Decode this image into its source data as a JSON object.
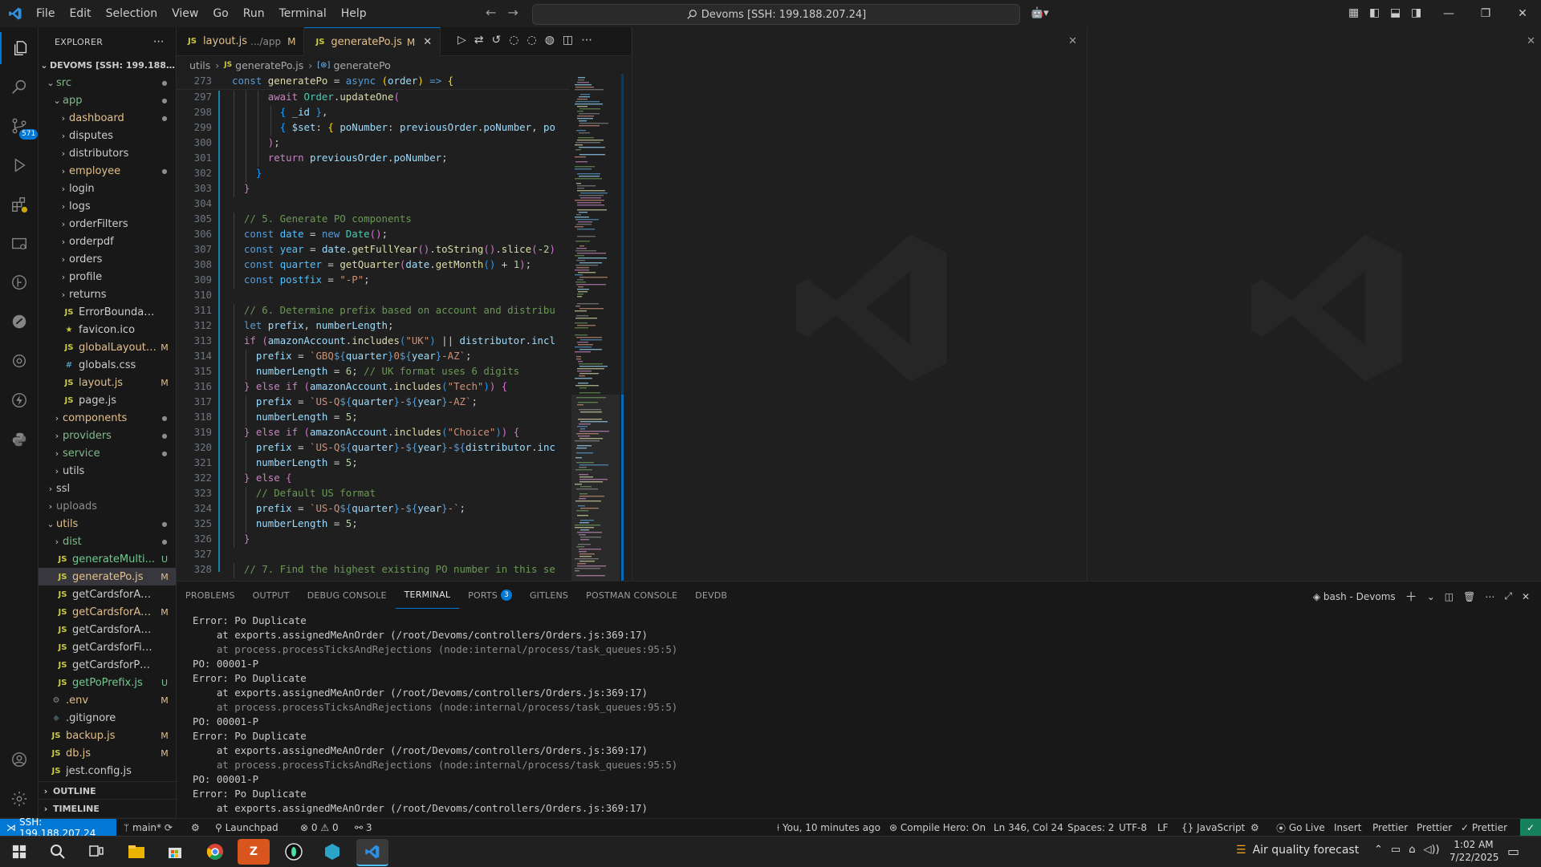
{
  "titlebar": {
    "menu": [
      "File",
      "Edit",
      "Selection",
      "View",
      "Go",
      "Run",
      "Terminal",
      "Help"
    ],
    "command_center": "Devoms [SSH: 199.188.207.24]"
  },
  "sidebar": {
    "title": "EXPLORER",
    "root": "DEVOMS [SSH: 199.188.20...",
    "rows": [
      {
        "label": "src",
        "type": "folder",
        "open": true,
        "indent": 1,
        "status": "dot",
        "color": "green"
      },
      {
        "label": "app",
        "type": "folder",
        "open": true,
        "indent": 2,
        "status": "dot",
        "color": "green"
      },
      {
        "label": "dashboard",
        "type": "folder",
        "open": false,
        "indent": 3,
        "status": "dot",
        "color": "mod"
      },
      {
        "label": "disputes",
        "type": "folder",
        "open": false,
        "indent": 3,
        "status": "",
        "color": "plain"
      },
      {
        "label": "distributors",
        "type": "folder",
        "open": false,
        "indent": 3,
        "status": "",
        "color": "plain"
      },
      {
        "label": "employee",
        "type": "folder",
        "open": false,
        "indent": 3,
        "status": "dot",
        "color": "mod"
      },
      {
        "label": "login",
        "type": "folder",
        "open": false,
        "indent": 3,
        "status": "",
        "color": "plain"
      },
      {
        "label": "logs",
        "type": "folder",
        "open": false,
        "indent": 3,
        "status": "",
        "color": "plain"
      },
      {
        "label": "orderFilters",
        "type": "folder",
        "open": false,
        "indent": 3,
        "status": "",
        "color": "plain"
      },
      {
        "label": "orderpdf",
        "type": "folder",
        "open": false,
        "indent": 3,
        "status": "",
        "color": "plain"
      },
      {
        "label": "orders",
        "type": "folder",
        "open": false,
        "indent": 3,
        "status": "",
        "color": "plain"
      },
      {
        "label": "profile",
        "type": "folder",
        "open": false,
        "indent": 3,
        "status": "",
        "color": "plain"
      },
      {
        "label": "returns",
        "type": "folder",
        "open": false,
        "indent": 3,
        "status": "",
        "color": "plain"
      },
      {
        "label": "ErrorBoundary.js",
        "type": "js",
        "indent": 3,
        "status": "",
        "color": "plain"
      },
      {
        "label": "favicon.ico",
        "type": "star",
        "indent": 3,
        "status": "",
        "color": "plain"
      },
      {
        "label": "globalLayout.js",
        "type": "js",
        "indent": 3,
        "status": "M",
        "color": "mod"
      },
      {
        "label": "globals.css",
        "type": "css",
        "indent": 3,
        "status": "",
        "color": "plain"
      },
      {
        "label": "layout.js",
        "type": "js",
        "indent": 3,
        "status": "M",
        "color": "mod"
      },
      {
        "label": "page.js",
        "type": "js",
        "indent": 3,
        "status": "",
        "color": "plain"
      },
      {
        "label": "components",
        "type": "folder",
        "open": false,
        "indent": 2,
        "status": "dot",
        "color": "mod"
      },
      {
        "label": "providers",
        "type": "folder",
        "open": false,
        "indent": 2,
        "status": "dot",
        "color": "green"
      },
      {
        "label": "service",
        "type": "folder",
        "open": false,
        "indent": 2,
        "status": "dot",
        "color": "green"
      },
      {
        "label": "utils",
        "type": "folder",
        "open": false,
        "indent": 2,
        "status": "",
        "color": "plain"
      },
      {
        "label": "ssl",
        "type": "folder",
        "open": false,
        "indent": 1,
        "status": "",
        "color": "plain"
      },
      {
        "label": "uploads",
        "type": "folder",
        "open": false,
        "indent": 1,
        "status": "",
        "color": "dim"
      },
      {
        "label": "utils",
        "type": "folder",
        "open": true,
        "indent": 1,
        "status": "dot",
        "color": "mod"
      },
      {
        "label": "dist",
        "type": "folder",
        "open": false,
        "indent": 2,
        "status": "dot",
        "color": "green"
      },
      {
        "label": "generateMulti...",
        "type": "js",
        "indent": 2,
        "status": "U",
        "color": "untracked"
      },
      {
        "label": "generatePo.js",
        "type": "js",
        "indent": 2,
        "status": "M",
        "color": "mod",
        "selected": true
      },
      {
        "label": "getCardsforAccount.js",
        "type": "js",
        "indent": 2,
        "status": "",
        "color": "plain"
      },
      {
        "label": "getCardsforAd...",
        "type": "js",
        "indent": 2,
        "status": "M",
        "color": "mod"
      },
      {
        "label": "getCardsforAmazon.js",
        "type": "js",
        "indent": 2,
        "status": "",
        "color": "plain"
      },
      {
        "label": "getCardsforFinance.js",
        "type": "js",
        "indent": 2,
        "status": "",
        "color": "plain"
      },
      {
        "label": "getCardsforPurchasi...",
        "type": "js",
        "indent": 2,
        "status": "",
        "color": "plain"
      },
      {
        "label": "getPoPrefix.js",
        "type": "js",
        "indent": 2,
        "status": "U",
        "color": "untracked"
      },
      {
        "label": ".env",
        "type": "gear",
        "indent": 1,
        "status": "M",
        "color": "mod"
      },
      {
        "label": ".gitignore",
        "type": "git",
        "indent": 1,
        "status": "",
        "color": "plain"
      },
      {
        "label": "backup.js",
        "type": "js",
        "indent": 1,
        "status": "M",
        "color": "mod"
      },
      {
        "label": "db.js",
        "type": "js",
        "indent": 1,
        "status": "M",
        "color": "mod"
      },
      {
        "label": "jest.config.js",
        "type": "js",
        "indent": 1,
        "status": "",
        "color": "plain"
      }
    ],
    "outline": "OUTLINE",
    "timeline": "TIMELINE"
  },
  "tabs": [
    {
      "label": "layout.js",
      "desc": ".../app",
      "status": "M",
      "active": false
    },
    {
      "label": "generatePo.js",
      "desc": "",
      "status": "M",
      "active": true
    }
  ],
  "breadcrumb": [
    "utils",
    "generatePo.js",
    "generatePo"
  ],
  "code": {
    "sticky_line": "273",
    "lines": [
      {
        "n": "297",
        "i": 3
      },
      {
        "n": "298",
        "i": 4
      },
      {
        "n": "299",
        "i": 4
      },
      {
        "n": "300",
        "i": 3
      },
      {
        "n": "301",
        "i": 3
      },
      {
        "n": "302",
        "i": 2
      },
      {
        "n": "303",
        "i": 1
      },
      {
        "n": "304",
        "i": 0
      },
      {
        "n": "305",
        "i": 1
      },
      {
        "n": "306",
        "i": 1
      },
      {
        "n": "307",
        "i": 1
      },
      {
        "n": "308",
        "i": 1
      },
      {
        "n": "309",
        "i": 1
      },
      {
        "n": "310",
        "i": 0
      },
      {
        "n": "311",
        "i": 1
      },
      {
        "n": "312",
        "i": 1
      },
      {
        "n": "313",
        "i": 1
      },
      {
        "n": "314",
        "i": 2
      },
      {
        "n": "315",
        "i": 2
      },
      {
        "n": "316",
        "i": 1
      },
      {
        "n": "317",
        "i": 2
      },
      {
        "n": "318",
        "i": 2
      },
      {
        "n": "319",
        "i": 1
      },
      {
        "n": "320",
        "i": 2
      },
      {
        "n": "321",
        "i": 2
      },
      {
        "n": "322",
        "i": 1
      },
      {
        "n": "323",
        "i": 2
      },
      {
        "n": "324",
        "i": 2
      },
      {
        "n": "325",
        "i": 2
      },
      {
        "n": "326",
        "i": 1
      },
      {
        "n": "327",
        "i": 0
      },
      {
        "n": "328",
        "i": 1
      }
    ]
  },
  "panel": {
    "tabs": [
      "PROBLEMS",
      "OUTPUT",
      "DEBUG CONSOLE",
      "TERMINAL",
      "PORTS",
      "GITLENS",
      "POSTMAN CONSOLE",
      "DEVDB"
    ],
    "active_tab": "TERMINAL",
    "ports_badge": "3",
    "terminal_name": "bash - Devoms",
    "terminal_lines": [
      {
        "text": "Error: Po Duplicate",
        "kind": "err"
      },
      {
        "text": "    at exports.assignedMeAnOrder (/root/Devoms/controllers/Orders.js:369:17)",
        "kind": "trace"
      },
      {
        "text": "    at process.processTicksAndRejections (node:internal/process/task_queues:95:5)",
        "kind": "dim"
      },
      {
        "text": "PO: 00001-P",
        "kind": "plain"
      },
      {
        "text": "Error: Po Duplicate",
        "kind": "err"
      },
      {
        "text": "    at exports.assignedMeAnOrder (/root/Devoms/controllers/Orders.js:369:17)",
        "kind": "trace"
      },
      {
        "text": "    at process.processTicksAndRejections (node:internal/process/task_queues:95:5)",
        "kind": "dim"
      },
      {
        "text": "PO: 00001-P",
        "kind": "plain"
      },
      {
        "text": "Error: Po Duplicate",
        "kind": "err"
      },
      {
        "text": "    at exports.assignedMeAnOrder (/root/Devoms/controllers/Orders.js:369:17)",
        "kind": "trace"
      },
      {
        "text": "    at process.processTicksAndRejections (node:internal/process/task_queues:95:5)",
        "kind": "dim"
      },
      {
        "text": "PO: 00001-P",
        "kind": "plain"
      },
      {
        "text": "Error: Po Duplicate",
        "kind": "err"
      },
      {
        "text": "    at exports.assignedMeAnOrder (/root/Devoms/controllers/Orders.js:369:17)",
        "kind": "trace"
      }
    ]
  },
  "statusbar": {
    "remote": "SSH: 199.188.207.24",
    "branch": "main*",
    "launchpad": "Launchpad",
    "errors": "0",
    "warnings": "0",
    "ports": "3",
    "blame": "You, 10 minutes ago",
    "compile_hero": "Compile Hero: On",
    "cursor": "Ln 346, Col 24",
    "spaces": "Spaces: 2",
    "encoding": "UTF-8",
    "eol": "LF",
    "language": "JavaScript",
    "go_live": "Go Live",
    "insert": "Insert",
    "prettier1": "Prettier",
    "prettier2": "Prettier",
    "prettier3": "Prettier"
  },
  "activity_badge": "571",
  "taskbar": {
    "weather": "Air quality forecast",
    "time": "1:02 AM",
    "date": "7/22/2025"
  }
}
